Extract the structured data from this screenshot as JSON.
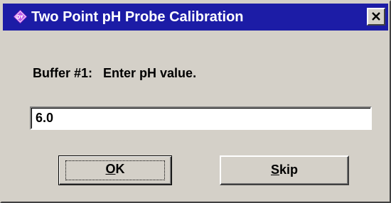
{
  "window": {
    "title": "Two Point pH Probe Calibration",
    "icon": "app-logo-icon",
    "close_icon": "close-icon"
  },
  "prompt": {
    "label": "Buffer #1:",
    "instruction": "Enter pH value."
  },
  "input": {
    "value": "6.0"
  },
  "buttons": {
    "ok": {
      "mnemonic": "O",
      "rest": "K",
      "label": "OK"
    },
    "skip": {
      "mnemonic": "S",
      "rest": "kip",
      "label": "Skip"
    }
  },
  "colors": {
    "titlebar": "#1c1ca6",
    "face": "#d4d0c8",
    "title_text": "#ffffff"
  }
}
